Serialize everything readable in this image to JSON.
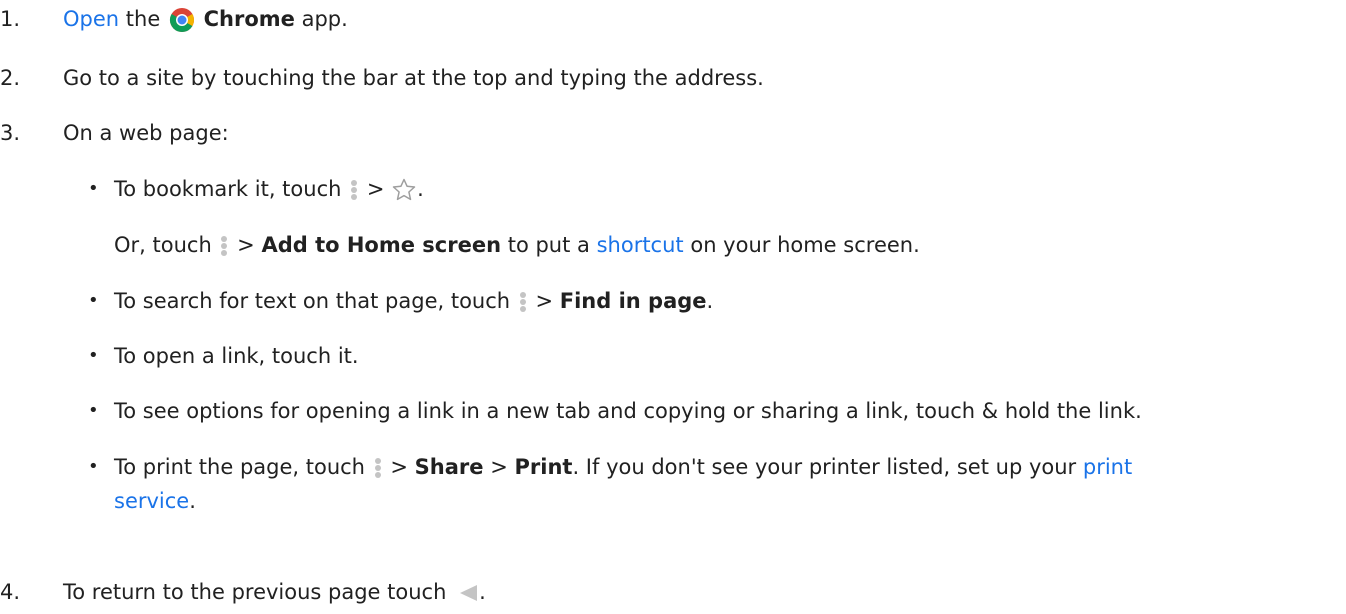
{
  "steps": [
    {
      "num": "1.",
      "open_link": "Open",
      "the": "the",
      "chrome": "Chrome",
      "app_suffix": "app."
    },
    {
      "num": "2.",
      "text": "Go to a site by touching the bar at the top and typing the address."
    },
    {
      "num": "3.",
      "text": "On a web page:"
    },
    {
      "num": "4.",
      "text": "To return to the previous page touch",
      "end": "."
    }
  ],
  "bullets": {
    "bookmark": {
      "bullet": "•",
      "pre": "To bookmark it, touch",
      "gt": ">",
      "end": "."
    },
    "home": {
      "pre": "Or, touch",
      "gt": ">",
      "bold": "Add to Home screen",
      "mid": "to put a",
      "link": "shortcut",
      "post": "on your home screen."
    },
    "find": {
      "bullet": "•",
      "pre": "To search for text on that page, touch",
      "gt": ">",
      "bold": "Find in page",
      "end": "."
    },
    "open": {
      "bullet": "•",
      "text": "To open a link, touch it."
    },
    "options": {
      "bullet": "•",
      "text": "To see options for opening a link in a new tab and copying or sharing a link, touch & hold the link."
    },
    "print": {
      "bullet": "•",
      "pre": "To print the page, touch",
      "gt1": ">",
      "share": "Share",
      "gt2": ">",
      "print": "Print",
      "mid": ". If you don't see your printer listed, set up your",
      "link1": "print",
      "link2": "service",
      "end": "."
    }
  },
  "icons": {
    "chrome": "chrome-icon",
    "menu": "more-vert-icon",
    "star": "star-icon",
    "back": "back-icon"
  },
  "colors": {
    "link": "#1a73e8",
    "text": "#212121",
    "icon_gray": "#c4c4c4"
  }
}
